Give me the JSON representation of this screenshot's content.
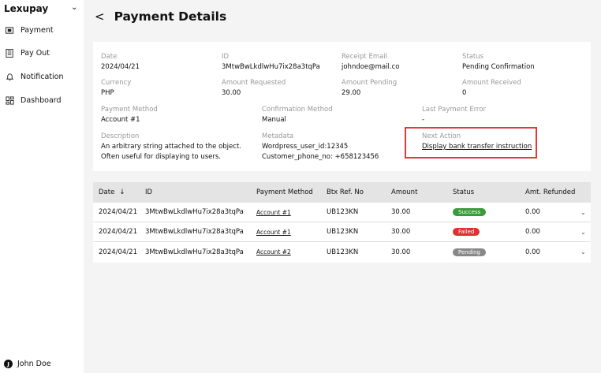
{
  "sidebar": {
    "brand": "Lexupay",
    "items": [
      {
        "label": "Payment",
        "icon": "banknote-icon"
      },
      {
        "label": "Pay Out",
        "icon": "list-icon"
      },
      {
        "label": "Notification",
        "icon": "bell-icon"
      },
      {
        "label": "Dashboard",
        "icon": "dashboard-icon"
      }
    ],
    "user": {
      "initial": "J",
      "name": "John Doe"
    }
  },
  "header": {
    "title": "Payment Details"
  },
  "details": {
    "date": {
      "label": "Date",
      "value": "2024/04/21"
    },
    "id": {
      "label": "ID",
      "value": "3MtwBwLkdlwHu7ix28a3tqPa"
    },
    "receipt_email": {
      "label": "Receipt Email",
      "value": "johndoe@mail.co"
    },
    "status": {
      "label": "Status",
      "value": "Pending Confirmation"
    },
    "currency": {
      "label": "Currency",
      "value": "PHP"
    },
    "amount_requested": {
      "label": "Amount Requested",
      "value": "30.00"
    },
    "amount_pending": {
      "label": "Amount Pending",
      "value": "29.00"
    },
    "amount_received": {
      "label": "Amount Received",
      "value": "0"
    },
    "payment_method": {
      "label": "Payment Method",
      "value": "Account #1"
    },
    "confirmation_method": {
      "label": "Confirmation Method",
      "value": "Manual"
    },
    "last_payment_error": {
      "label": "Last Payment Error",
      "value": "-"
    },
    "description": {
      "label": "Description",
      "value": "An arbitrary string attached to the object. Often useful for displaying to users."
    },
    "metadata": {
      "label": "Metadata",
      "line1": "Wordpress_user_id:12345",
      "line2": "Customer_phone_no: +658123456"
    },
    "next_action": {
      "label": "Next Action",
      "value": "Display bank transfer instruction"
    }
  },
  "table": {
    "headers": [
      "Date",
      "ID",
      "Payment Method",
      "Btx Ref. No",
      "Amount",
      "Status",
      "Amt. Refunded"
    ],
    "rows": [
      {
        "date": "2024/04/21",
        "id": "3MtwBwLkdlwHu7ix28a3tqPa",
        "method": "Account #1",
        "ref": "UB123KN",
        "amount": "30.00",
        "status": "Success",
        "status_color": "#3a9b3a",
        "refunded": "0.00"
      },
      {
        "date": "2024/04/21",
        "id": "3MtwBwLkdlwHu7ix28a3tqPa",
        "method": "Account #1",
        "ref": "UB123KN",
        "amount": "30.00",
        "status": "Failed",
        "status_color": "#e03131",
        "refunded": "0.00"
      },
      {
        "date": "2024/04/21",
        "id": "3MtwBwLkdlwHu7ix28a3tqPa",
        "method": "Account #2",
        "ref": "UB123KN",
        "amount": "30.00",
        "status": "Pending",
        "status_color": "#888888",
        "refunded": "0.00"
      }
    ]
  },
  "colors": {
    "highlight": "#e53935",
    "background": "#f4f4f4"
  }
}
